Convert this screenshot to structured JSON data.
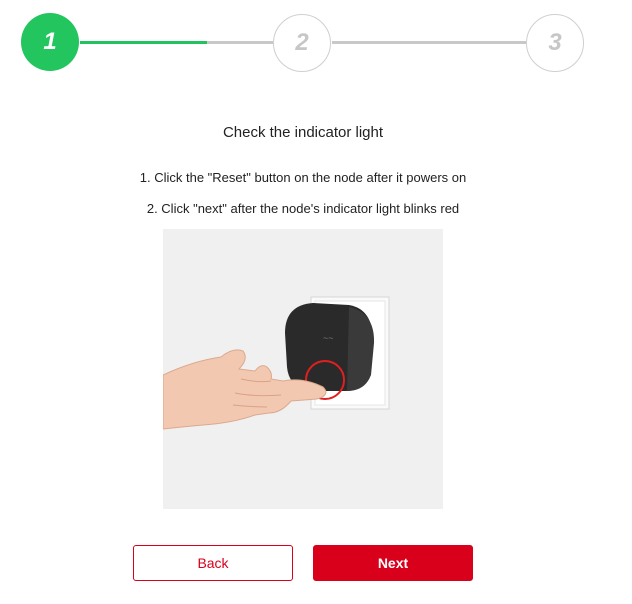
{
  "stepper": {
    "steps": [
      {
        "number": "1",
        "state": "active"
      },
      {
        "number": "2",
        "state": "inactive"
      },
      {
        "number": "3",
        "state": "inactive"
      }
    ],
    "progress_between_1_and_2": 0.66,
    "active_color": "#22c55e",
    "inactive_color": "#c7c7c7"
  },
  "content": {
    "title": "Check the indicator light",
    "instructions": [
      "1. Click the \"Reset\" button on the node after it powers on",
      "2. Click \"next\" after the node's indicator light blinks red"
    ]
  },
  "illustration": {
    "icon": "hand-pressing-reset-button-on-node",
    "highlight_color": "#e02020"
  },
  "buttons": {
    "back_label": "Back",
    "next_label": "Next",
    "accent_color": "#d9001b"
  }
}
